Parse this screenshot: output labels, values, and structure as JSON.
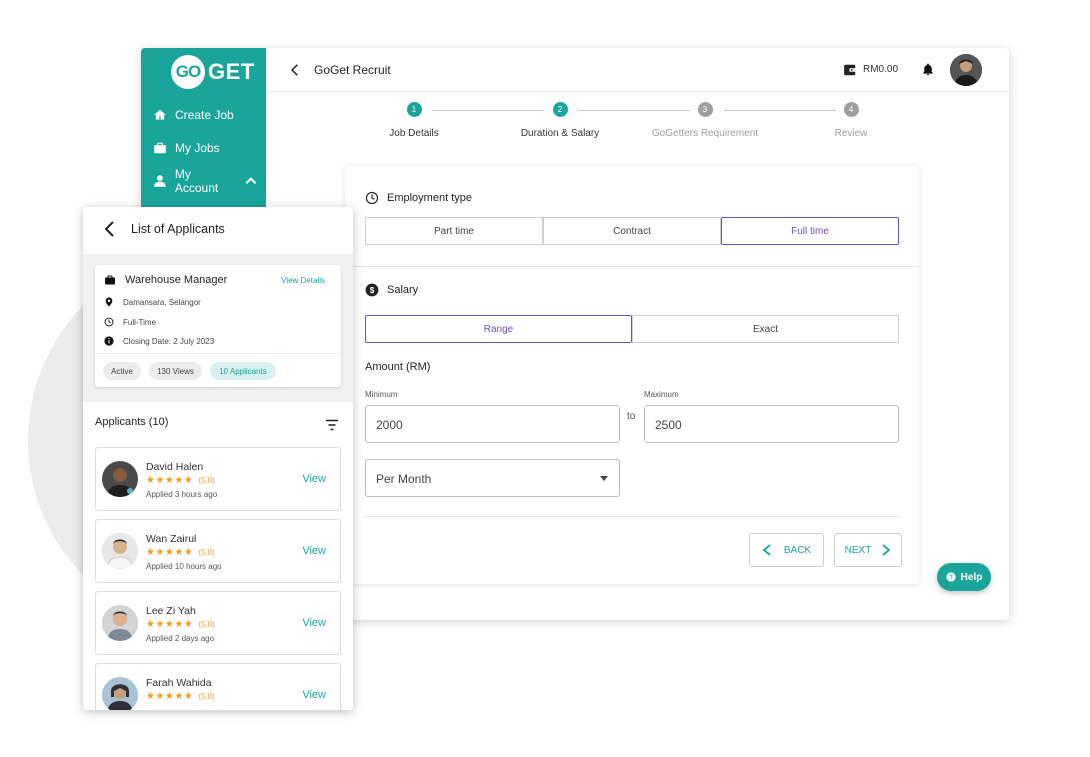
{
  "app": {
    "logo_go": "GO",
    "logo_get": "GET",
    "title": "GoGet Recruit",
    "wallet_amount": "RM0.00"
  },
  "sidebar": {
    "items": [
      {
        "label": "Create Job",
        "icon": "home-icon"
      },
      {
        "label": "My Jobs",
        "icon": "briefcase-icon"
      },
      {
        "label": "My Account",
        "icon": "user-icon"
      }
    ]
  },
  "stepper": {
    "steps": [
      {
        "number": "1",
        "label": "Job Details",
        "state": "done"
      },
      {
        "number": "2",
        "label": "Duration & Salary",
        "state": "active"
      },
      {
        "number": "3",
        "label": "GoGetters Requirement",
        "state": "pending"
      },
      {
        "number": "4",
        "label": "Review",
        "state": "pending"
      }
    ]
  },
  "form": {
    "employment_title": "Employment type",
    "employment_options": [
      "Part time",
      "Contract",
      "Full time"
    ],
    "employment_selected": "Full time",
    "salary_title": "Salary",
    "salary_options": [
      "Range",
      "Exact"
    ],
    "salary_selected": "Range",
    "amount_label": "Amount (RM)",
    "minimum_label": "Minimum",
    "minimum_value": "2000",
    "to_label": "to",
    "maximum_label": "Maximum",
    "maximum_value": "2500",
    "period_value": "Per Month",
    "back_label": "BACK",
    "next_label": "NEXT"
  },
  "help_label": "Help",
  "mobile": {
    "title": "List of Applicants",
    "job": {
      "title": "Warehouse Manager",
      "view_details": "View Details",
      "location": "Damansara, Selangor",
      "type": "Full-Time",
      "closing": "Closing Date: 2 July 2023",
      "status": "Active",
      "views": "130 Views",
      "applicants": "10 Applicants"
    },
    "applicants_heading": "Applicants (10)",
    "applicants": [
      {
        "name": "David Halen",
        "stars": "★★★★★",
        "rating": "(5.0)",
        "applied": "Applied 3 hours ago",
        "view": "View"
      },
      {
        "name": "Wan Zairul",
        "stars": "★★★★★",
        "rating": "(5.0)",
        "applied": "Applied 10 hours ago",
        "view": "View"
      },
      {
        "name": "Lee Zi Yah",
        "stars": "★★★★★",
        "rating": "(5.0)",
        "applied": "Applied 2 days ago",
        "view": "View"
      },
      {
        "name": "Farah Wahida",
        "stars": "★★★★★",
        "rating": "(5.0)",
        "applied": "",
        "view": "View"
      }
    ]
  },
  "colors": {
    "brand": "#1aa59b",
    "selected": "#6b4fbb",
    "star": "#f29c1f"
  }
}
